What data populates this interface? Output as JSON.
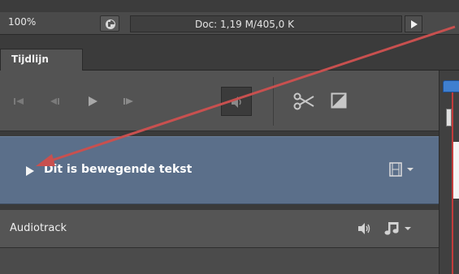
{
  "statusbar": {
    "zoom": "100%",
    "doc_info": "Doc: 1,19 M/405,0 K",
    "doc_icon": "doc-stats-icon",
    "menu_arrow_icon": "play-right-icon"
  },
  "panel": {
    "tab_label": "Tijdlijn"
  },
  "toolbar": {
    "icons": [
      "skip-to-start-icon",
      "step-back-icon",
      "play-icon",
      "step-forward-icon",
      "mute-audio-icon",
      "scissors-icon",
      "transition-icon"
    ]
  },
  "layers": [
    {
      "name": "Dit is bewegende tekst",
      "icon": "film-strip-icon"
    }
  ],
  "audio": {
    "name": "Audiotrack",
    "icons": [
      "speaker-icon",
      "music-note-icon"
    ]
  },
  "colors": {
    "accent": "#5b6f8a",
    "playhead": "#c23b3b",
    "annotation_arrow": "#c8504f",
    "panel": "#535353"
  }
}
